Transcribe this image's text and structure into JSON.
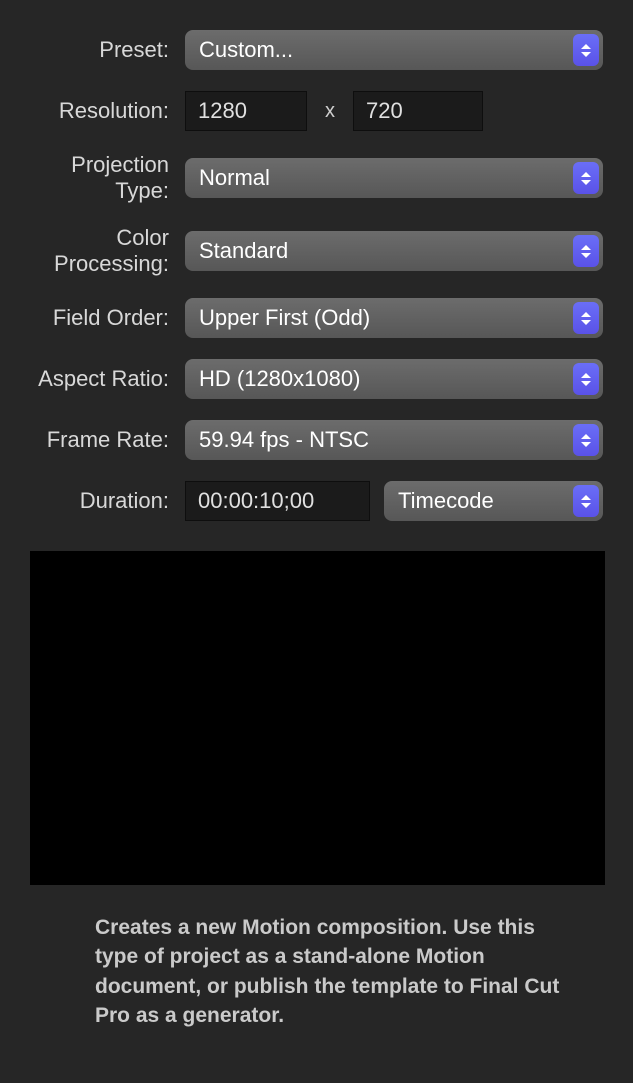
{
  "labels": {
    "preset": "Preset:",
    "resolution": "Resolution:",
    "projection": "Projection Type:",
    "colorProcessing": "Color Processing:",
    "fieldOrder": "Field Order:",
    "aspectRatio": "Aspect Ratio:",
    "frameRate": "Frame Rate:",
    "duration": "Duration:"
  },
  "values": {
    "preset": "Custom...",
    "resolutionWidth": "1280",
    "resolutionX": "x",
    "resolutionHeight": "720",
    "projection": "Normal",
    "colorProcessing": "Standard",
    "fieldOrder": "Upper First (Odd)",
    "aspectRatio": "HD (1280x1080)",
    "frameRate": "59.94 fps - NTSC",
    "duration": "00:00:10;00",
    "durationMode": "Timecode"
  },
  "description": "Creates a new Motion composition. Use this type of project as a stand-alone Motion document, or publish the template to Final Cut Pro as a generator."
}
